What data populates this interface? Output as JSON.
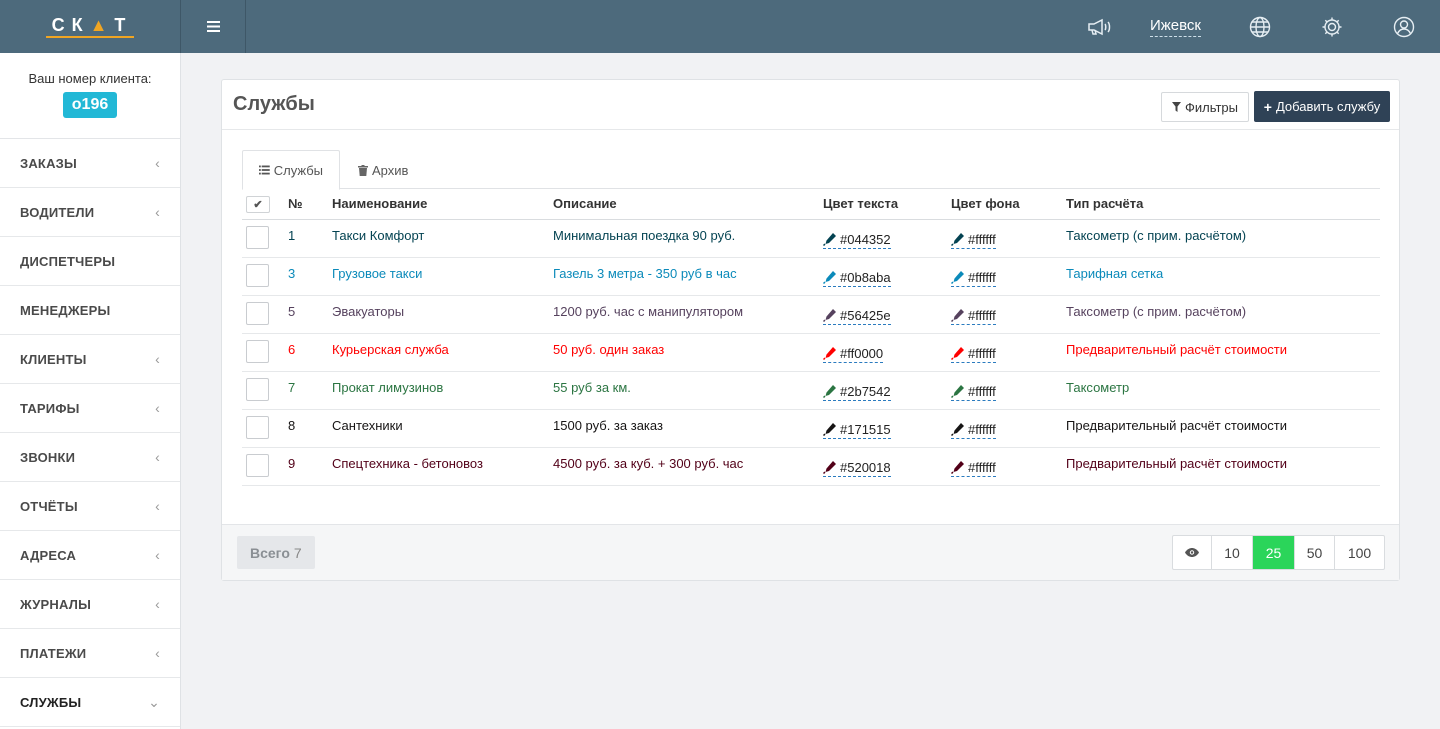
{
  "header": {
    "logo_text_1": "СК",
    "logo_text_2": "Т",
    "city": "Ижевск",
    "icons": [
      "menu-icon",
      "megaphone-icon",
      "globe-icon",
      "gear-icon",
      "user-icon"
    ]
  },
  "sidebar": {
    "client_label": "Ваш номер клиента:",
    "client_number": "o196",
    "items": [
      {
        "label": "ЗАКАЗЫ",
        "chevron": "‹"
      },
      {
        "label": "ВОДИТЕЛИ",
        "chevron": "‹"
      },
      {
        "label": "ДИСПЕТЧЕРЫ",
        "chevron": ""
      },
      {
        "label": "МЕНЕДЖЕРЫ",
        "chevron": ""
      },
      {
        "label": "КЛИЕНТЫ",
        "chevron": "‹"
      },
      {
        "label": "ТАРИФЫ",
        "chevron": "‹"
      },
      {
        "label": "ЗВОНКИ",
        "chevron": "‹"
      },
      {
        "label": "ОТЧЁТЫ",
        "chevron": "‹"
      },
      {
        "label": "АДРЕСА",
        "chevron": "‹"
      },
      {
        "label": "ЖУРНАЛЫ",
        "chevron": "‹"
      },
      {
        "label": "ПЛАТЕЖИ",
        "chevron": "‹"
      },
      {
        "label": "СЛУЖБЫ",
        "chevron": "⌄"
      }
    ]
  },
  "panel": {
    "title": "Службы",
    "filter_label": "Фильтры",
    "add_label": "Добавить службу",
    "tabs": {
      "services": "Службы",
      "archive": "Архив"
    }
  },
  "table": {
    "headers": {
      "num": "№",
      "name": "Наименование",
      "desc": "Описание",
      "text_color": "Цвет текста",
      "bg_color": "Цвет фона",
      "calc": "Тип расчёта"
    },
    "rows": [
      {
        "num": "1",
        "name": "Такси Комфорт",
        "desc": "Минимальная поездка 90 руб.",
        "text_color": "#044352",
        "bg_color": "#ffffff",
        "calc": "Таксометр (с прим. расчётом)"
      },
      {
        "num": "3",
        "name": "Грузовое такси",
        "desc": "Газель 3 метра - 350 руб в час",
        "text_color": "#0b8aba",
        "bg_color": "#ffffff",
        "calc": "Тарифная сетка"
      },
      {
        "num": "5",
        "name": "Эвакуаторы",
        "desc": "1200 руб. час с манипулятором",
        "text_color": "#56425e",
        "bg_color": "#ffffff",
        "calc": "Таксометр (с прим. расчётом)"
      },
      {
        "num": "6",
        "name": "Курьерская служба",
        "desc": "50 руб. один заказ",
        "text_color": "#ff0000",
        "bg_color": "#ffffff",
        "calc": "Предварительный расчёт стоимости"
      },
      {
        "num": "7",
        "name": "Прокат лимузинов",
        "desc": "55 руб за км.",
        "text_color": "#2b7542",
        "bg_color": "#ffffff",
        "calc": "Таксометр"
      },
      {
        "num": "8",
        "name": "Сантехники",
        "desc": "1500 руб. за заказ",
        "text_color": "#171515",
        "bg_color": "#ffffff",
        "calc": "Предварительный расчёт стоимости"
      },
      {
        "num": "9",
        "name": "Спецтехника - бетоновоз",
        "desc": "4500 руб. за куб. + 300 руб. час",
        "text_color": "#520018",
        "bg_color": "#ffffff",
        "calc": "Предварительный расчёт стоимости"
      }
    ]
  },
  "footer": {
    "total_label": "Всего",
    "total_count": "7",
    "page_sizes": [
      "10",
      "25",
      "50",
      "100"
    ],
    "active_page_size": "25"
  }
}
